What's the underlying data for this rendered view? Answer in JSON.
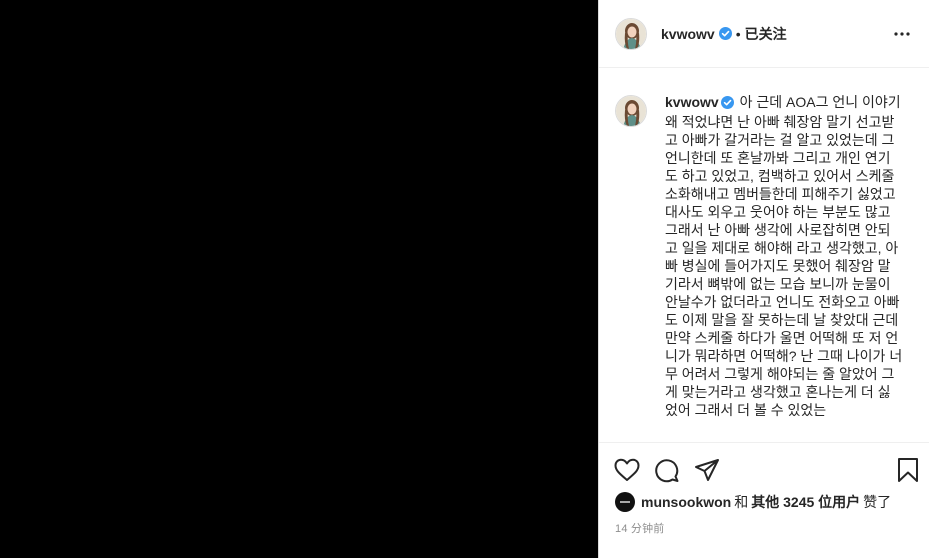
{
  "post": {
    "username": "kvwowv",
    "verified": true,
    "separator": "•",
    "follow_status": "已关注",
    "caption": "아 근데 AOA그 언니 이야기 왜 적었냐면 난 아빠 췌장암 말기 선고받고 아빠가 갈거라는 걸 알고 있었는데 그 언니한데 또 혼날까봐 그리고 개인 연기도 하고 있었고, 컴백하고 있어서 스케줄 소화해내고 멤버들한데 피해주기 싫었고 대사도 외우고 웃어야 하는 부분도 많고 그래서 난 아빠 생각에 사로잡히면 안되고 일을 제대로 해야해 라고 생각했고, 아빠 병실에 들어가지도 못했어 췌장암 말기라서 뼈밖에 없는 모습 보니까 눈물이 안날수가 없더라고 언니도 전화오고 아빠도 이제 말을 잘 못하는데 날 찾았대 근데 만약 스케줄 하다가 울면 어떡해 또 저 언니가 뭐라하면 어떡해? 난 그때 나이가 너무 어려서 그렇게 해야되는 줄 알았어 그게 맞는거라고 생각했고 혼나는게 더 싫었어 그래서 더 볼 수 있었는"
  },
  "likes": {
    "user": "munsookwon",
    "connector": "和",
    "others": "其他 3245 位用户",
    "suffix": "赞了"
  },
  "timestamp": "14 分钟前",
  "icons": {
    "more": "more-options-icon",
    "like": "heart-icon",
    "comment": "comment-icon",
    "share": "share-icon",
    "save": "bookmark-icon",
    "verified": "verified-badge-icon"
  },
  "colors": {
    "verified": "#3897f0",
    "text": "#262626",
    "muted": "#8e8e8e",
    "media_bg": "#000000"
  }
}
